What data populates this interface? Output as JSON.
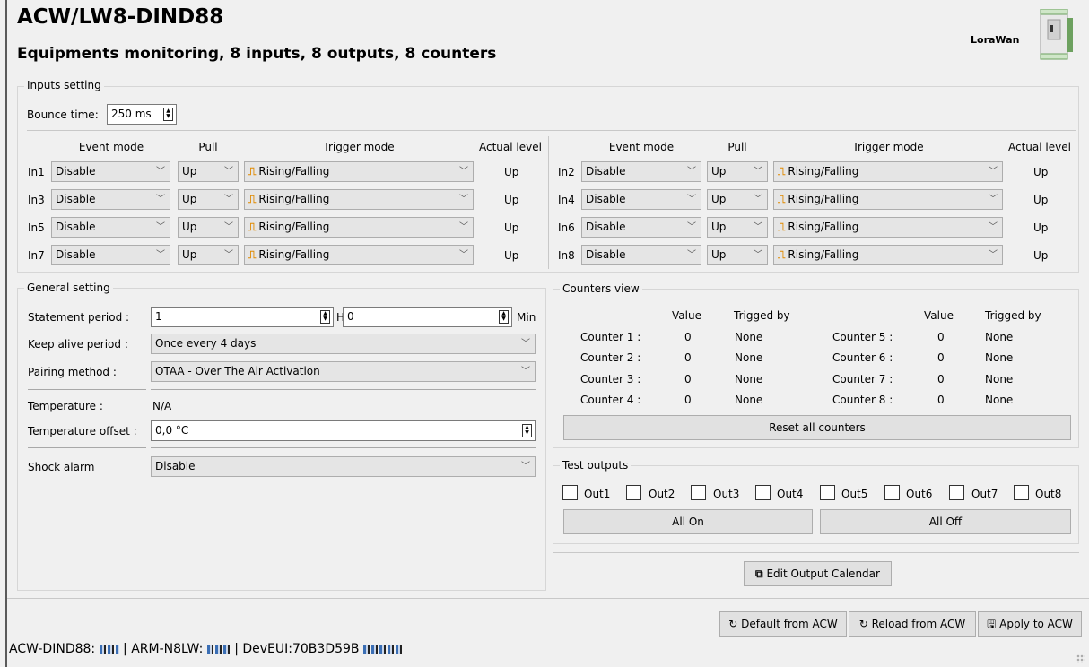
{
  "header": {
    "title": "ACW/LW8-DIND88",
    "subtitle": "Equipments monitoring, 8 inputs, 8 outputs, 8 counters",
    "network": "LoraWan",
    "device_icon": "din-rail-device-icon"
  },
  "inputs_setting": {
    "title": "Inputs setting",
    "bounce_label": "Bounce time:",
    "bounce_value": "250 ms",
    "columns": {
      "event_mode": "Event mode",
      "pull": "Pull",
      "trigger_mode": "Trigger mode",
      "actual_level": "Actual level"
    },
    "inputs": [
      {
        "name": "In1",
        "event_mode": "Disable",
        "pull": "Up",
        "trigger": "Rising/Falling",
        "level": "Up"
      },
      {
        "name": "In2",
        "event_mode": "Disable",
        "pull": "Up",
        "trigger": "Rising/Falling",
        "level": "Up"
      },
      {
        "name": "In3",
        "event_mode": "Disable",
        "pull": "Up",
        "trigger": "Rising/Falling",
        "level": "Up"
      },
      {
        "name": "In4",
        "event_mode": "Disable",
        "pull": "Up",
        "trigger": "Rising/Falling",
        "level": "Up"
      },
      {
        "name": "In5",
        "event_mode": "Disable",
        "pull": "Up",
        "trigger": "Rising/Falling",
        "level": "Up"
      },
      {
        "name": "In6",
        "event_mode": "Disable",
        "pull": "Up",
        "trigger": "Rising/Falling",
        "level": "Up"
      },
      {
        "name": "In7",
        "event_mode": "Disable",
        "pull": "Up",
        "trigger": "Rising/Falling",
        "level": "Up"
      },
      {
        "name": "In8",
        "event_mode": "Disable",
        "pull": "Up",
        "trigger": "Rising/Falling",
        "level": "Up"
      }
    ]
  },
  "general_setting": {
    "title": "General setting",
    "statement_period_label": "Statement period :",
    "statement_hours": "1",
    "hours_unit": "H",
    "statement_minutes": "0",
    "minutes_unit": "Min",
    "keep_alive_label": "Keep alive period :",
    "keep_alive_value": "Once every 4 days",
    "pairing_label": "Pairing method :",
    "pairing_value": "OTAA - Over The Air Activation",
    "temperature_label": "Temperature :",
    "temperature_value": "N/A",
    "temp_offset_label": "Temperature offset :",
    "temp_offset_value": "0,0 °C",
    "shock_label": "Shock alarm",
    "shock_value": "Disable"
  },
  "counters_view": {
    "title": "Counters view",
    "value_header": "Value",
    "trigged_header": "Trigged by",
    "counters": [
      {
        "label": "Counter 1 :",
        "value": "0",
        "trigged_by": "None"
      },
      {
        "label": "Counter 2 :",
        "value": "0",
        "trigged_by": "None"
      },
      {
        "label": "Counter 3 :",
        "value": "0",
        "trigged_by": "None"
      },
      {
        "label": "Counter 4 :",
        "value": "0",
        "trigged_by": "None"
      },
      {
        "label": "Counter 5 :",
        "value": "0",
        "trigged_by": "None"
      },
      {
        "label": "Counter 6 :",
        "value": "0",
        "trigged_by": "None"
      },
      {
        "label": "Counter 7 :",
        "value": "0",
        "trigged_by": "None"
      },
      {
        "label": "Counter 8 :",
        "value": "0",
        "trigged_by": "None"
      }
    ],
    "reset_label": "Reset all counters"
  },
  "test_outputs": {
    "title": "Test outputs",
    "outputs": [
      {
        "label": "Out1",
        "checked": false
      },
      {
        "label": "Out2",
        "checked": false
      },
      {
        "label": "Out3",
        "checked": false
      },
      {
        "label": "Out4",
        "checked": false
      },
      {
        "label": "Out5",
        "checked": false
      },
      {
        "label": "Out6",
        "checked": false
      },
      {
        "label": "Out7",
        "checked": false
      },
      {
        "label": "Out8",
        "checked": false
      }
    ],
    "all_on_label": "All On",
    "all_off_label": "All Off"
  },
  "edit_calendar_label": "Edit Output Calendar",
  "footer": {
    "default_label": "Default from ACW",
    "reload_label": "Reload from ACW",
    "apply_label": "Apply to ACW"
  },
  "status": {
    "device_prefix": "ACW-DIND88:",
    "sep1": "| ARM-N8LW:",
    "sep2": "| DevEUI:70B3D59B"
  },
  "icons": {
    "trigger": "rising-falling-edge-icon",
    "dropdown": "chevron-down-icon",
    "external": "external-link-icon",
    "refresh": "refresh-icon",
    "save": "save-icon"
  }
}
